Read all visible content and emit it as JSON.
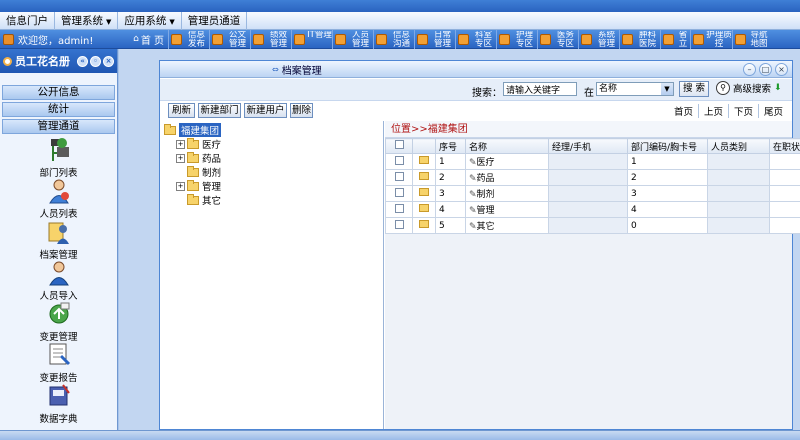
{
  "menubar": {
    "items": [
      {
        "label": "信息门户",
        "dropdown": false
      },
      {
        "label": "管理系统",
        "dropdown": true
      },
      {
        "label": "应用系统",
        "dropdown": true
      },
      {
        "label": "管理员通道",
        "dropdown": false
      }
    ]
  },
  "navbar": {
    "welcome": "欢迎您，admin!",
    "home": "首 页",
    "items": [
      "信息发布",
      "公文管理",
      "绩效管理",
      "IT管理",
      "人员管理",
      "信息沟通",
      "日常管理",
      "科室专区",
      "护理专区",
      "医务专区",
      "系统管理",
      "肿科医院",
      "省立",
      "护理质控",
      "导航地图"
    ]
  },
  "left_panel": {
    "title": "员工花名册",
    "buttons": [
      "公开信息",
      "统计",
      "管理通道"
    ],
    "items": [
      {
        "label": "部门列表",
        "icon": "tree-icon"
      },
      {
        "label": "人员列表",
        "icon": "person-icon"
      },
      {
        "label": "档案管理",
        "icon": "archive-icon"
      },
      {
        "label": "人员导入",
        "icon": "import-person-icon"
      },
      {
        "label": "变更管理",
        "icon": "change-icon"
      },
      {
        "label": "变更报告",
        "icon": "report-icon"
      },
      {
        "label": "数据字典",
        "icon": "dictionary-icon"
      }
    ]
  },
  "main": {
    "tab_title": "档案管理",
    "search": {
      "label": "搜索：",
      "placeholder": "请输入关键字",
      "value": "请输入关键字",
      "in_label": "在",
      "field_value": "名称",
      "button": "搜 索",
      "advanced": "高级搜索"
    },
    "toolbar": [
      "刷新",
      "新建部门",
      "新建用户",
      "删除"
    ],
    "pager": [
      "首页",
      "上页",
      "下页",
      "尾页"
    ],
    "tree": {
      "root": "福建集团",
      "children": [
        "医疗",
        "药品",
        "制剂",
        "管理",
        "其它"
      ],
      "expandable": [
        true,
        true,
        false,
        true,
        false
      ]
    },
    "location": "位置>>福建集团",
    "table": {
      "headers": [
        "",
        "",
        "序号",
        "名称",
        "经理/手机",
        "部门编码/胸卡号",
        "人员类别",
        "在职状态"
      ],
      "rows": [
        {
          "seq": "1",
          "name": "医疗",
          "manager": "",
          "code": "1"
        },
        {
          "seq": "2",
          "name": "药品",
          "manager": "",
          "code": "2"
        },
        {
          "seq": "3",
          "name": "制剂",
          "manager": "",
          "code": "3"
        },
        {
          "seq": "4",
          "name": "管理",
          "manager": "",
          "code": "4"
        },
        {
          "seq": "5",
          "name": "其它",
          "manager": "",
          "code": "0"
        }
      ]
    }
  },
  "colors": {
    "accent": "#2a64c2",
    "location_text": "#b01414",
    "folder": "#f7d36a"
  }
}
